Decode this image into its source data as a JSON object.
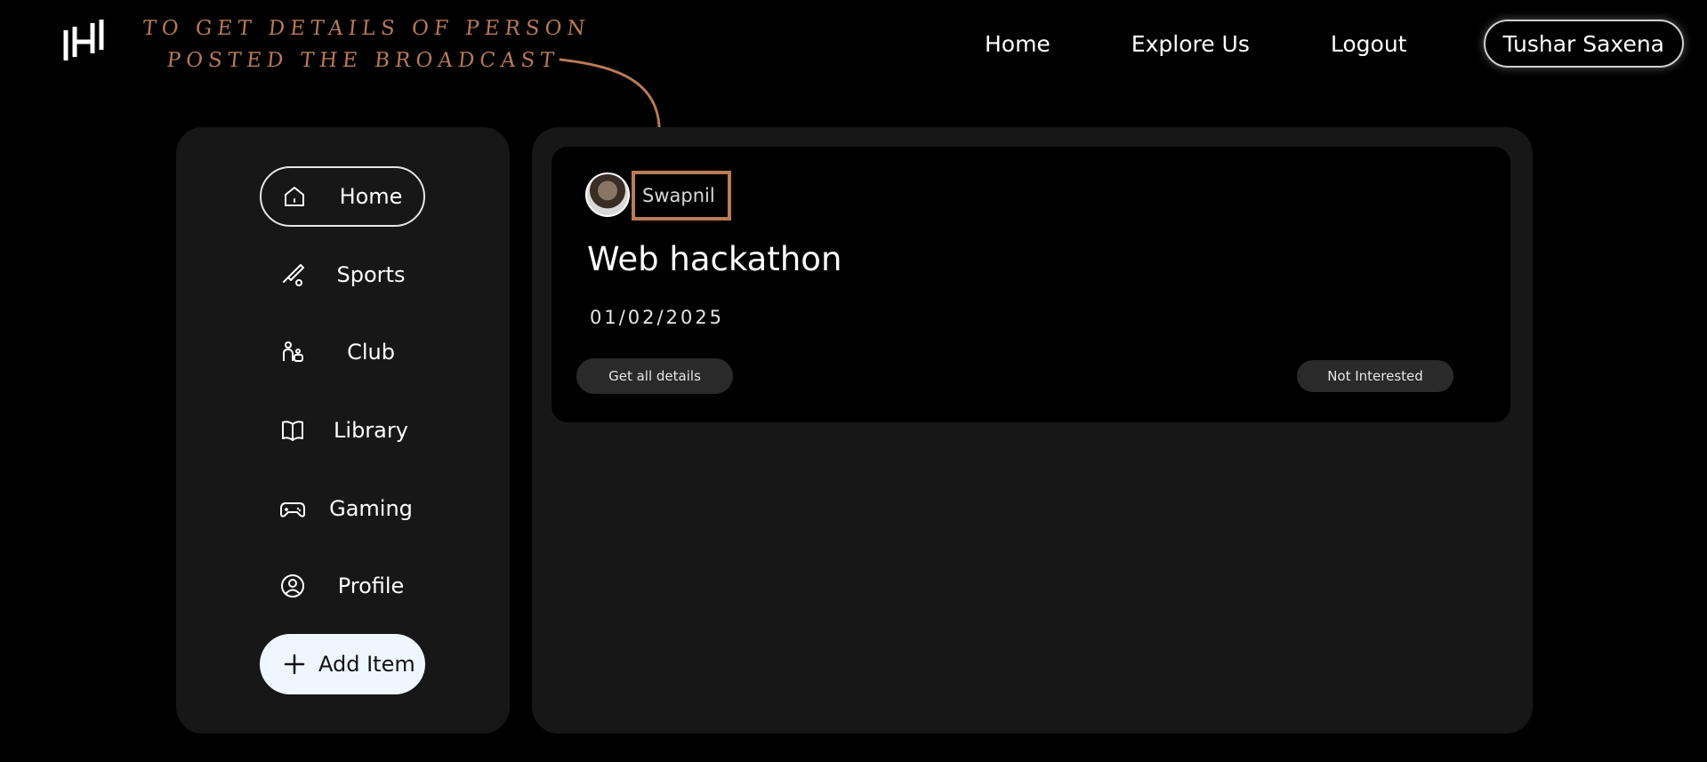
{
  "annotation": {
    "line1": "TO GET DETAILS OF PERSON",
    "line2": "POSTED THE BROADCAST",
    "color": "#b87a57"
  },
  "nav": {
    "home": "Home",
    "explore": "Explore Us",
    "logout": "Logout",
    "user": "Tushar Saxena"
  },
  "sidebar": {
    "items": [
      {
        "label": "Home",
        "icon": "home-icon",
        "active": true
      },
      {
        "label": "Sports",
        "icon": "bat-ball-icon"
      },
      {
        "label": "Club",
        "icon": "club-icon"
      },
      {
        "label": "Library",
        "icon": "book-icon"
      },
      {
        "label": "Gaming",
        "icon": "gamepad-icon"
      },
      {
        "label": "Profile",
        "icon": "user-circle-icon"
      }
    ],
    "add_button": "Add Item"
  },
  "card": {
    "author": "Swapnil",
    "title": "Web hackathon",
    "date": "01/02/2025",
    "details_button": "Get all details",
    "not_interested_button": "Not Interested"
  },
  "colors": {
    "background": "#000000",
    "panel": "#171717",
    "accent": "#b87a57",
    "add_button_bg": "#eef6ff"
  }
}
